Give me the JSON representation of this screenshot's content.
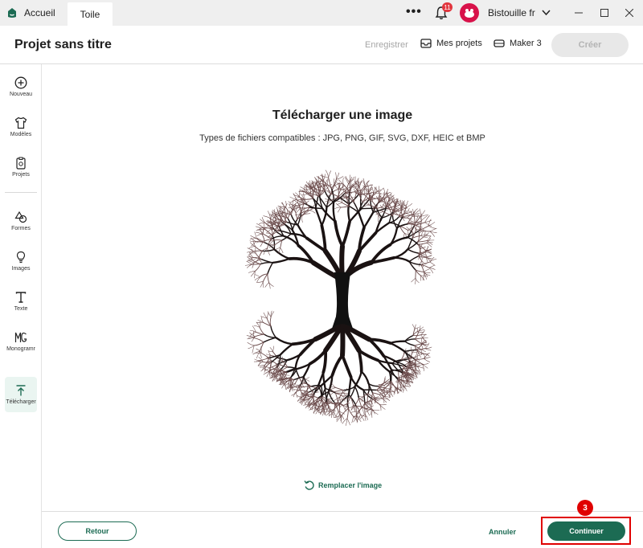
{
  "titlebar": {
    "home_tab": "Accueil",
    "active_tab": "Toile",
    "more_icon": "more-icon",
    "notification_count": "11",
    "username": "Bistouille fr"
  },
  "header": {
    "project_title": "Projet sans titre",
    "save_label": "Enregistrer",
    "my_projects_label": "Mes projets",
    "machine_label": "Maker 3",
    "create_label": "Créer"
  },
  "sidebar": {
    "items": [
      {
        "label": "Nouveau",
        "icon": "plus-circle-icon"
      },
      {
        "label": "Modèles",
        "icon": "shirt-icon"
      },
      {
        "label": "Projets",
        "icon": "project-icon"
      },
      {
        "label": "Formes",
        "icon": "shapes-icon"
      },
      {
        "label": "Images",
        "icon": "lightbulb-icon"
      },
      {
        "label": "Texte",
        "icon": "text-icon"
      },
      {
        "label": "Monogramr",
        "icon": "monogram-icon"
      },
      {
        "label": "Télécharger",
        "icon": "upload-icon"
      }
    ]
  },
  "main": {
    "title": "Télécharger une image",
    "file_types": "Types de fichiers compatibles :  JPG, PNG, GIF, SVG, DXF, HEIC et BMP",
    "replace_label": "Remplacer l'image"
  },
  "footer": {
    "back_label": "Retour",
    "cancel_label": "Annuler",
    "continue_label": "Continuer",
    "step_badge": "3"
  },
  "colors": {
    "brand": "#1c6b53",
    "highlight": "#e00000",
    "notification": "#e2363e"
  }
}
